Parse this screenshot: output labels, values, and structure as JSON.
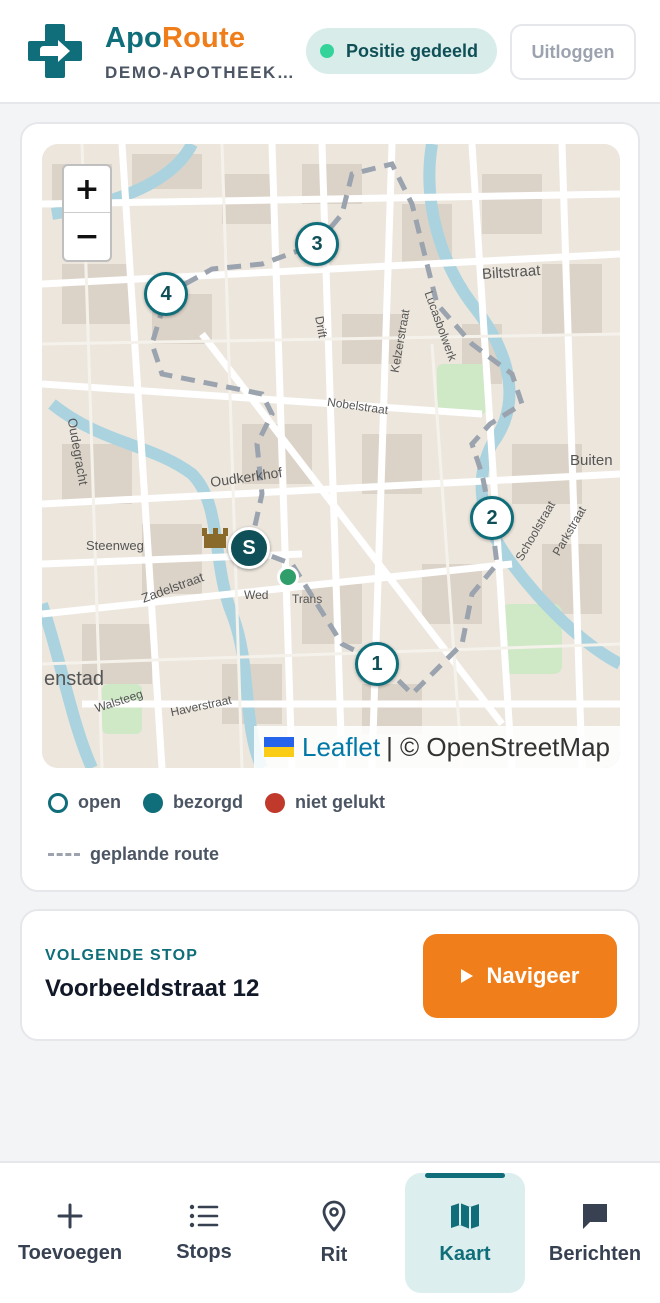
{
  "header": {
    "brand_part1": "Apo",
    "brand_part2": "Route",
    "pharmacy": "DEMO-APOTHEEK…",
    "position_status": "Positie gedeeld",
    "logout_label": "Uitloggen",
    "colors": {
      "primary": "#0f6e7a",
      "accent": "#ef7d1a",
      "status_dot": "#34d399"
    }
  },
  "map": {
    "zoom_in": "+",
    "zoom_out": "−",
    "start_label": "S",
    "stops": [
      "1",
      "2",
      "3",
      "4"
    ],
    "street_labels": [
      "Biltstraat",
      "Oudkerkhof",
      "Steenweg",
      "Zadelstraat",
      "Oudegracht",
      "Nobelstraat",
      "Buiten",
      "Trans",
      "Wed",
      "Walsteeg",
      "Haverstraat",
      "Lucasbolwerk",
      "Kelzerstraat",
      "Drift",
      "Schoolstraat",
      "Parkstraat",
      "enstad"
    ],
    "attribution_link": "Leaflet",
    "attribution_text": "| © OpenStreetMap"
  },
  "legend": {
    "open": "open",
    "done": "bezorgd",
    "failed": "niet gelukt",
    "route": "geplande route",
    "colors": {
      "open": "#0f6e7a",
      "done": "#0f6e7a",
      "failed": "#c0392b",
      "route": "#9ca3af"
    }
  },
  "next_stop": {
    "label": "VOLGENDE STOP",
    "address": "Voorbeeldstraat 12",
    "navigate_label": "Navigeer"
  },
  "bottom_nav": {
    "tabs": [
      {
        "label": "Toevoegen",
        "icon": "plus-icon"
      },
      {
        "label": "Stops",
        "icon": "list-icon"
      },
      {
        "label": "Rit",
        "icon": "map-pin-icon"
      },
      {
        "label": "Kaart",
        "icon": "map-icon",
        "active": true
      },
      {
        "label": "Berichten",
        "icon": "message-icon"
      }
    ]
  }
}
